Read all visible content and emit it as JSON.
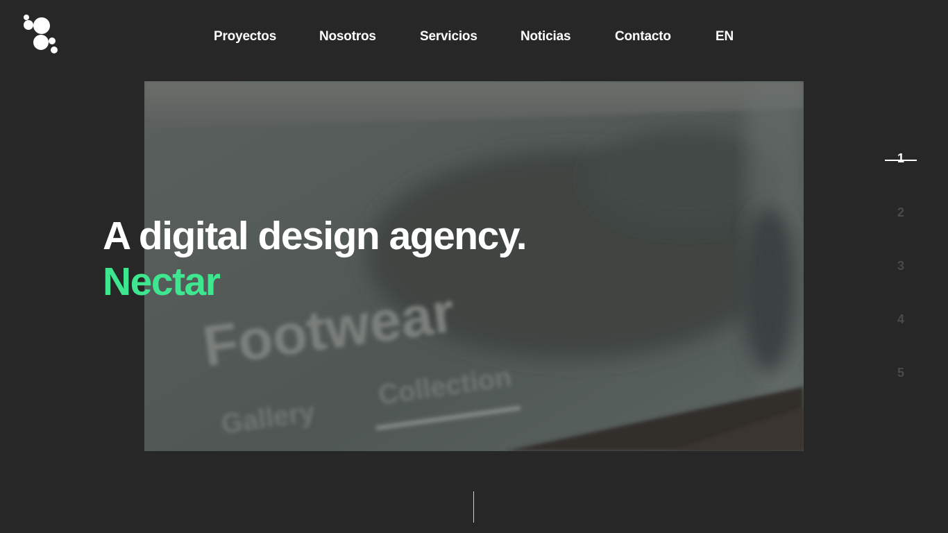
{
  "header": {
    "logo_icon": "bubbles-logo-icon",
    "nav": [
      {
        "label": "Proyectos"
      },
      {
        "label": "Nosotros"
      },
      {
        "label": "Servicios"
      },
      {
        "label": "Noticias"
      },
      {
        "label": "Contacto"
      },
      {
        "label": "EN"
      }
    ]
  },
  "hero": {
    "title": "A digital design agency.",
    "brand": "Nectar",
    "brand_color": "#3de68f",
    "image": {
      "headline": "Footwear",
      "link_left": "Gallery",
      "link_right": "Collection"
    }
  },
  "pager": {
    "active_index": 1,
    "items": [
      "1",
      "2",
      "3",
      "4",
      "5"
    ]
  },
  "colors": {
    "background": "#272727",
    "accent": "#3de68f",
    "text": "#ffffff",
    "pager_inactive": "#4a4a4a"
  }
}
